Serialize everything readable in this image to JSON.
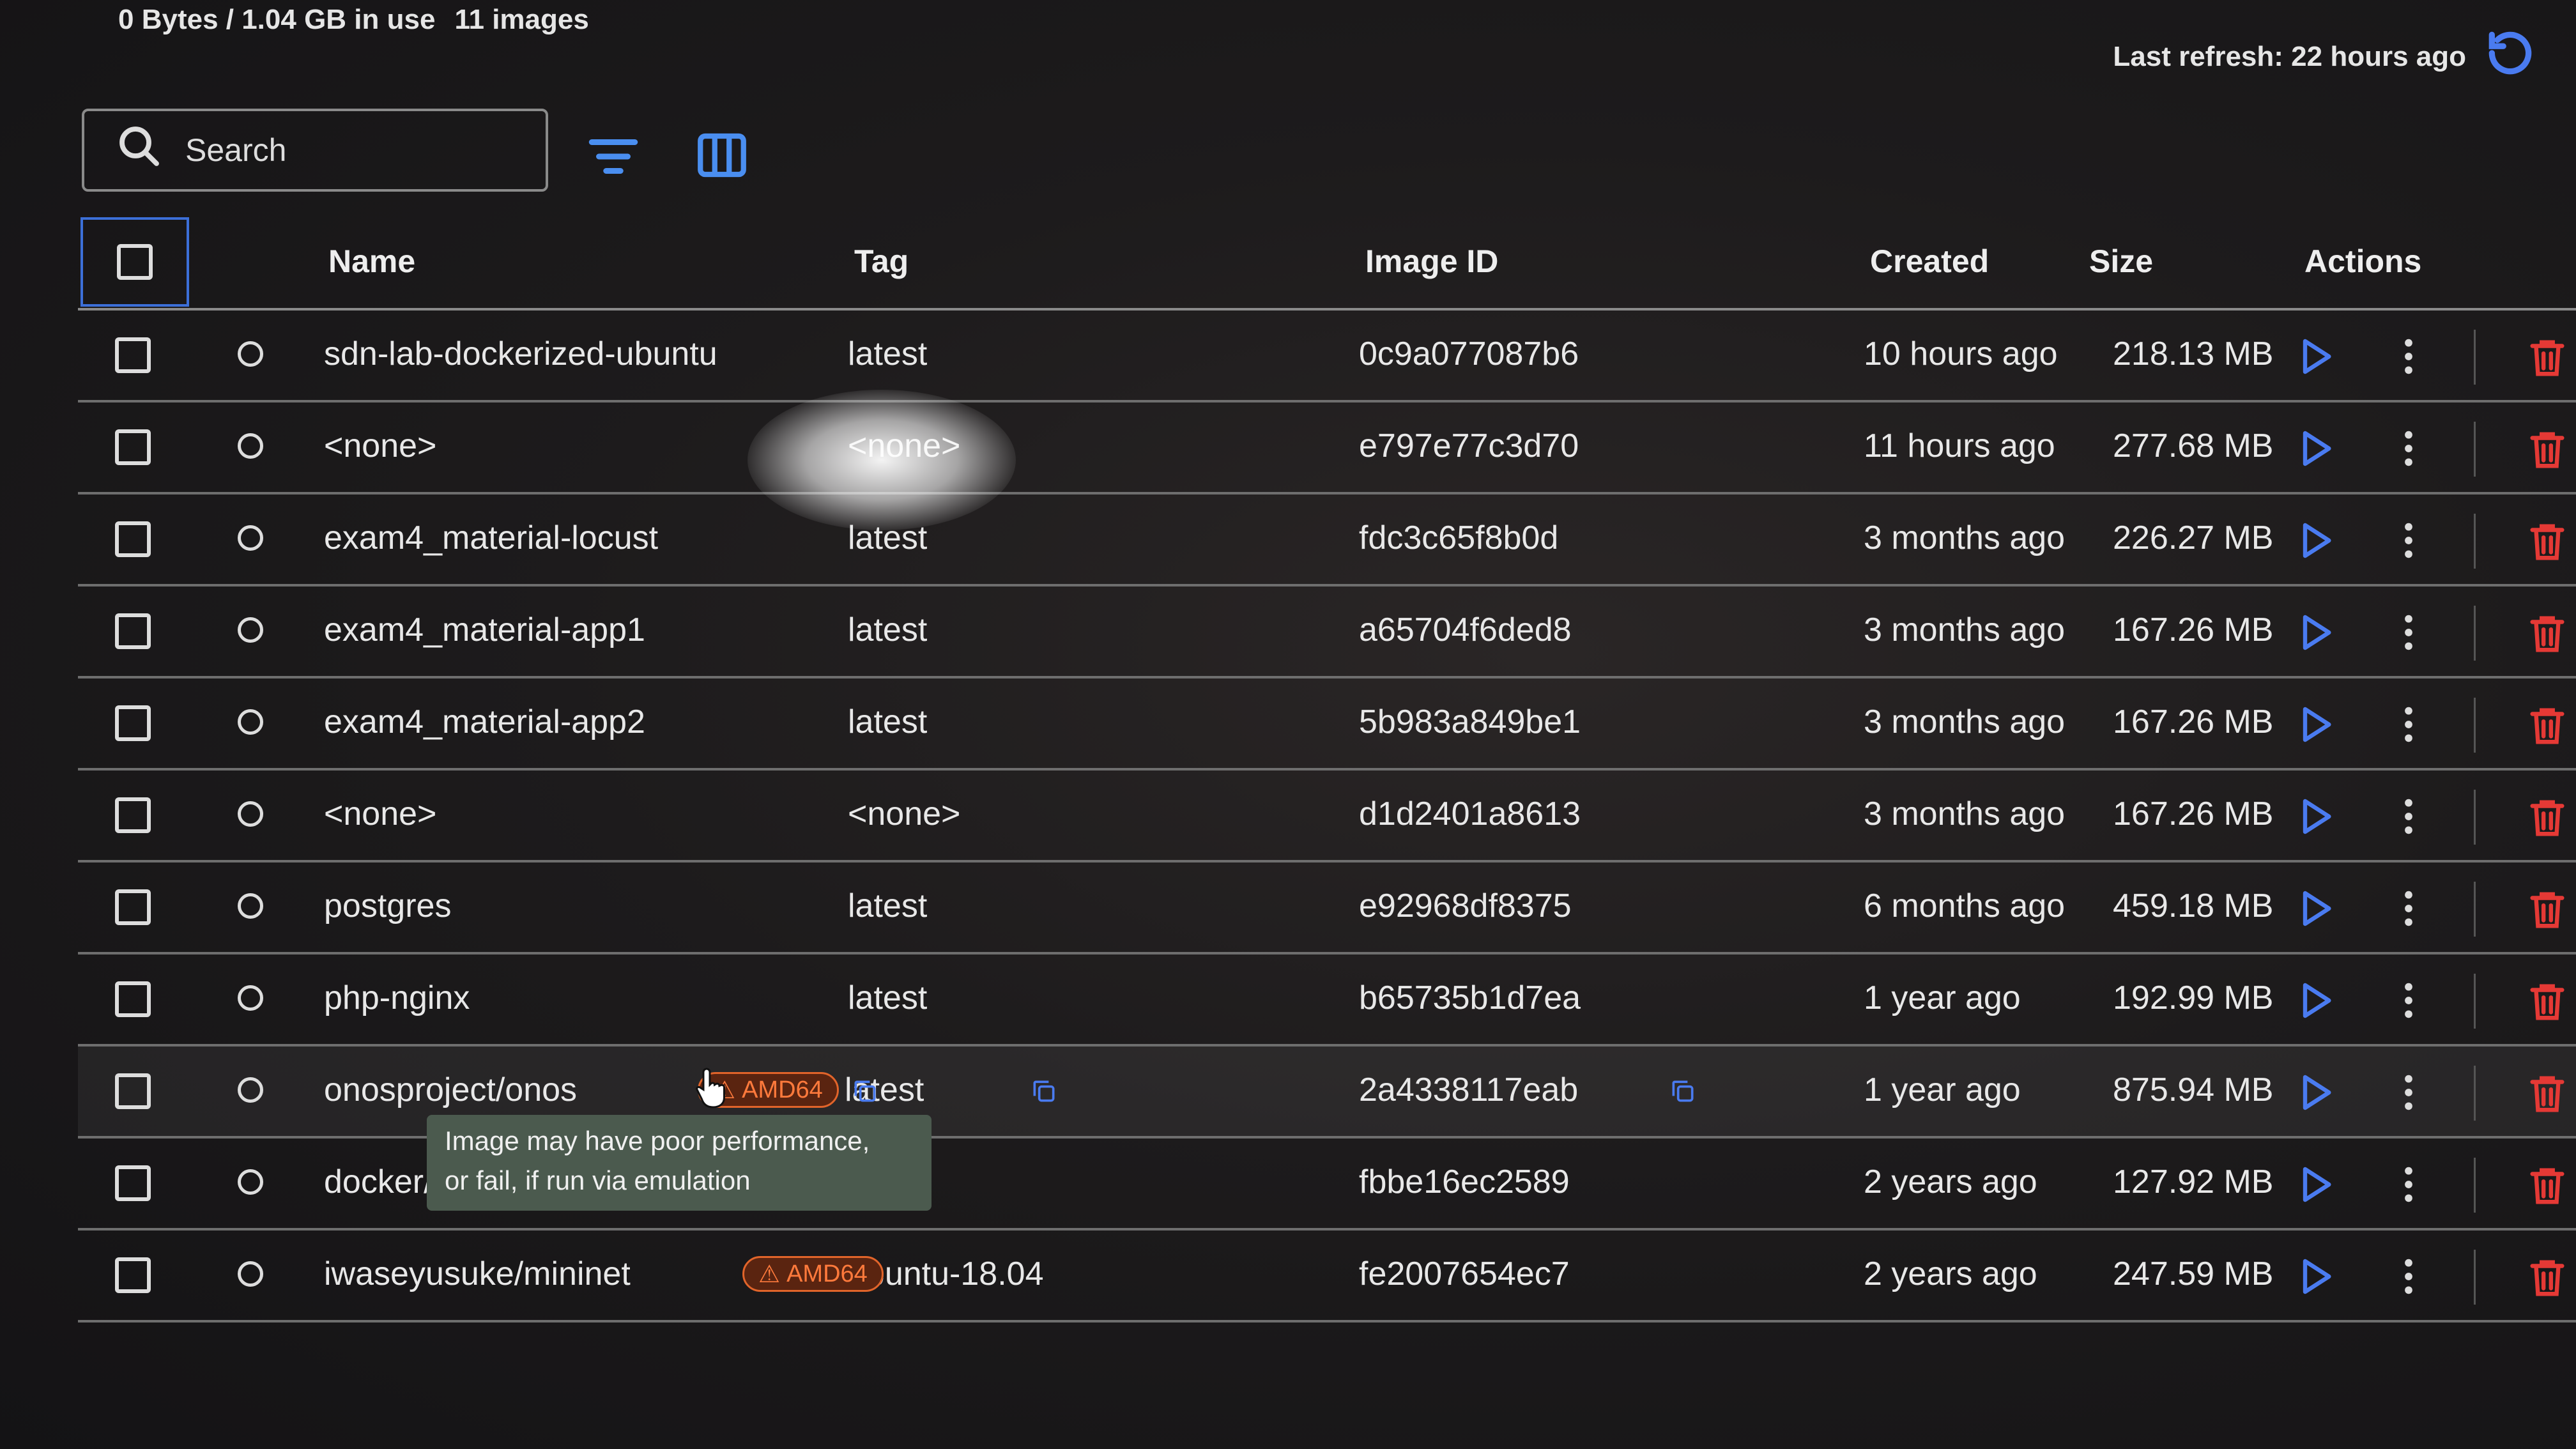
{
  "header": {
    "usage": "0 Bytes / 1.04 GB in use",
    "count": "11 images",
    "refresh": "Last refresh: 22 hours ago"
  },
  "search": {
    "placeholder": "Search"
  },
  "columns": {
    "name": "Name",
    "tag": "Tag",
    "image_id": "Image ID",
    "created": "Created",
    "size": "Size",
    "actions": "Actions"
  },
  "rows": [
    {
      "name": "sdn-lab-dockerized-ubuntu",
      "tag": "latest",
      "id": "0c9a077087b6",
      "created": "10 hours ago",
      "size": "218.13 MB"
    },
    {
      "name": "<none>",
      "tag": "<none>",
      "id": "e797e77c3d70",
      "created": "11 hours ago",
      "size": "277.68 MB"
    },
    {
      "name": "exam4_material-locust",
      "tag": "latest",
      "id": "fdc3c65f8b0d",
      "created": "3 months ago",
      "size": "226.27 MB"
    },
    {
      "name": "exam4_material-app1",
      "tag": "latest",
      "id": "a65704f6ded8",
      "created": "3 months ago",
      "size": "167.26 MB"
    },
    {
      "name": "exam4_material-app2",
      "tag": "latest",
      "id": "5b983a849be1",
      "created": "3 months ago",
      "size": "167.26 MB"
    },
    {
      "name": "<none>",
      "tag": "<none>",
      "id": "d1d2401a8613",
      "created": "3 months ago",
      "size": "167.26 MB"
    },
    {
      "name": "postgres",
      "tag": "latest",
      "id": "e92968df8375",
      "created": "6 months ago",
      "size": "459.18 MB"
    },
    {
      "name": "php-nginx",
      "tag": "latest",
      "id": "b65735b1d7ea",
      "created": "1 year ago",
      "size": "192.99 MB"
    },
    {
      "name": "onosproject/onos",
      "tag": "latest",
      "id": "2a4338117eab",
      "created": "1 year ago",
      "size": "875.94 MB",
      "badge": "AMD64"
    },
    {
      "name": "docker/",
      "tag": "",
      "id": "fbbe16ec2589",
      "created": "2 years ago",
      "size": "127.92 MB"
    },
    {
      "name": "iwaseyusuke/mininet",
      "tag": "ubuntu-18.04",
      "id": "fe2007654ec7",
      "created": "2 years ago",
      "size": "247.59 MB",
      "badge": "AMD64"
    }
  ],
  "tooltip": {
    "line1": "Image may have poor performance,",
    "line2": "or fail, if run via emulation"
  },
  "colors": {
    "accent": "#3c6fd8",
    "delete": "#e53935",
    "badge": "#e1642a",
    "play": "#4a7bf0"
  }
}
